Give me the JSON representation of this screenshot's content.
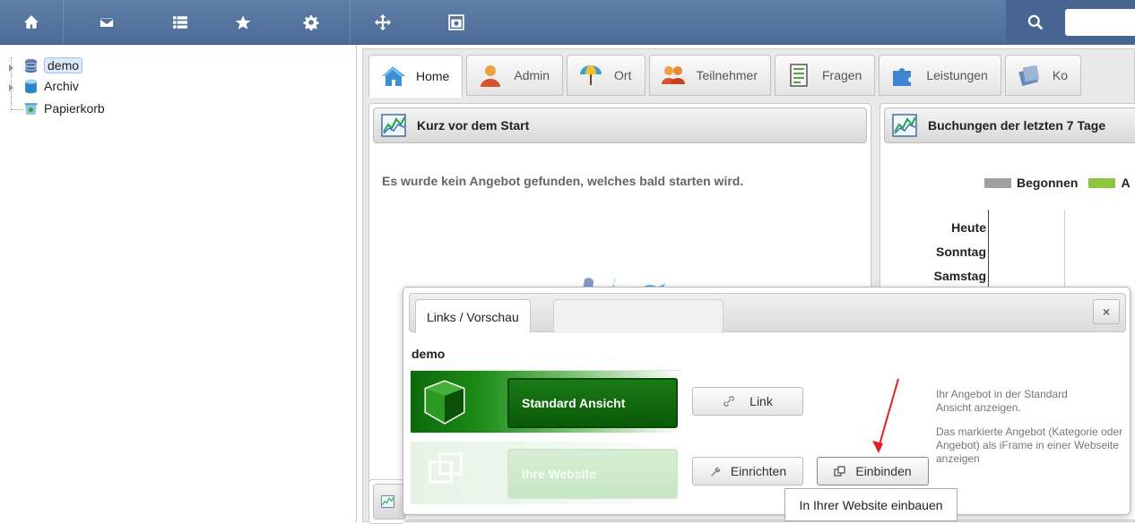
{
  "toolbar": {
    "buttons": [
      {
        "name": "home-icon"
      },
      {
        "name": "mail-icon"
      },
      {
        "name": "list-icon"
      },
      {
        "name": "star-icon"
      },
      {
        "name": "gear-icon"
      },
      {
        "name": "move-icon"
      },
      {
        "name": "screenshot-icon"
      }
    ],
    "search_placeholder": ""
  },
  "tree": {
    "items": [
      {
        "label": "demo",
        "icon": "database-icon",
        "selected": true
      },
      {
        "label": "Archiv",
        "icon": "archive-icon"
      },
      {
        "label": "Papierkorb",
        "icon": "trash-icon"
      }
    ]
  },
  "tabs": [
    {
      "label": "Home",
      "icon": "home-icon",
      "active": true
    },
    {
      "label": "Admin",
      "icon": "user-icon"
    },
    {
      "label": "Ort",
      "icon": "umbrella-icon"
    },
    {
      "label": "Teilnehmer",
      "icon": "users-icon"
    },
    {
      "label": "Fragen",
      "icon": "document-icon"
    },
    {
      "label": "Leistungen",
      "icon": "puzzle-icon"
    },
    {
      "label": "Ko",
      "icon": "catalog-icon"
    }
  ],
  "panel_left": {
    "title": "Kurz vor dem Start",
    "message": "Es wurde kein Angebot gefunden, welches bald starten wird."
  },
  "panel_right": {
    "title": "Buchungen der letzten 7 Tage",
    "legend": [
      {
        "label": "Begonnen",
        "color": "#a0a0a0"
      },
      {
        "label": "A",
        "color": "#8cc63f"
      }
    ],
    "days": [
      "Heute",
      "Sonntag",
      "Samstag"
    ]
  },
  "dialog": {
    "tab_label": "Links / Vorschau",
    "close_label": "×",
    "title": "demo",
    "rows": [
      {
        "button_label": "Standard Ansicht",
        "action_label": "Link",
        "description": "Ihr Angebot in der Standard Ansicht anzeigen."
      },
      {
        "button_label": "Ihre Website",
        "action_label": "Einrichten",
        "action2_label": "Einbinden",
        "description": "Das markierte Angebot (Kategorie oder Angebot) als iFrame in einer Webseite anzeigen"
      }
    ]
  },
  "tooltip": "In Ihrer Website einbauen",
  "colors": {
    "toolbar": "#5677a2",
    "green": "#0b5a08",
    "arrow": "#e02020"
  }
}
